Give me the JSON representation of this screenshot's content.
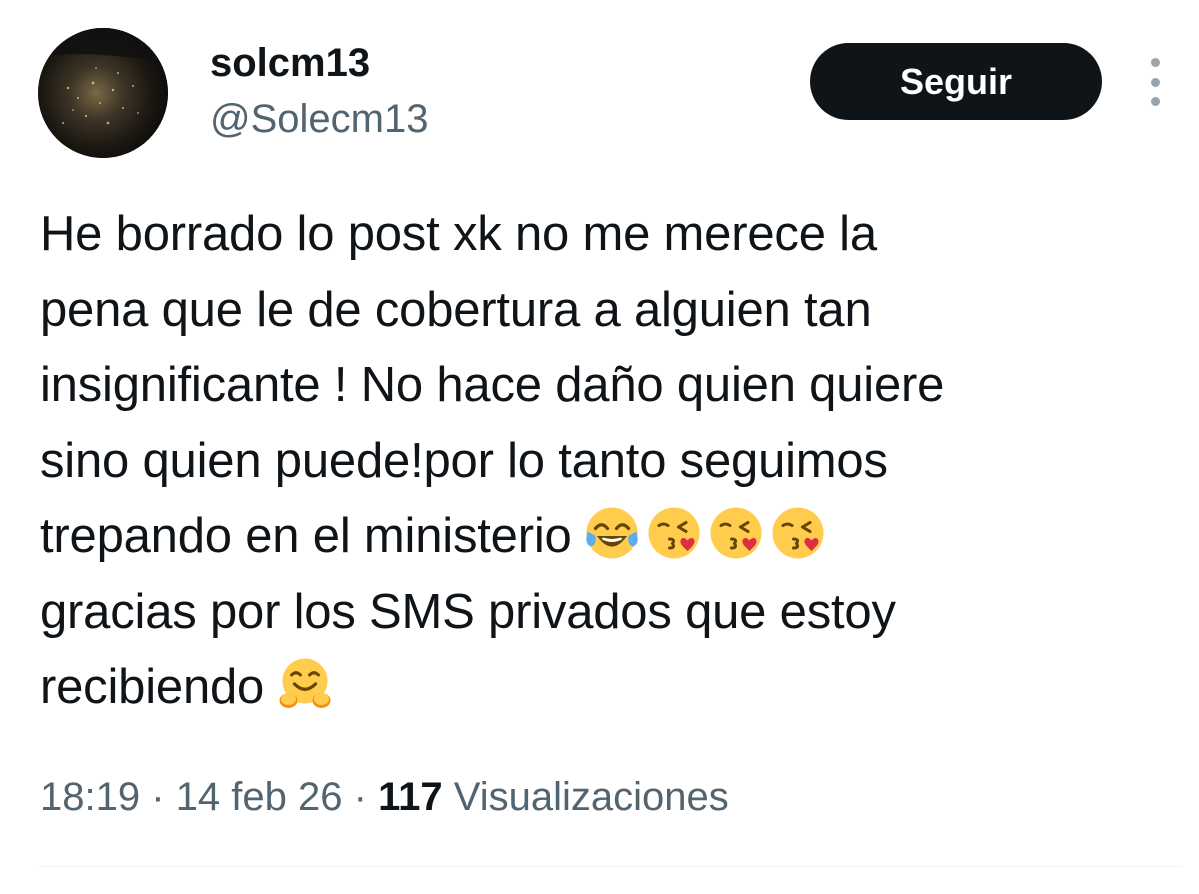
{
  "author": {
    "display_name": "solcm13",
    "handle": "@Solecm13"
  },
  "follow_button": {
    "label": "Seguir"
  },
  "more_menu": {
    "icon": "more-vertical-icon"
  },
  "post": {
    "lines": [
      "He borrado lo post xk no me merece la",
      "pena que le de cobertura a alguien tan",
      "insignificante ! No hace daño quien quiere",
      "sino quien puede!por lo tanto seguimos",
      "trepando en el ministerio",
      "gracias por los SMS privados que estoy",
      "recibiendo"
    ],
    "emojis_line5": [
      "face-with-tears-of-joy",
      "face-blowing-a-kiss",
      "face-blowing-a-kiss",
      "face-blowing-a-kiss"
    ],
    "emojis_line7": [
      "hugging-face"
    ]
  },
  "meta": {
    "time": "18:19",
    "sep1": "·",
    "date": "14 feb 26",
    "sep2": "·",
    "views_count": "117",
    "views_label": "Visualizaciones"
  },
  "colors": {
    "text": "#0f1419",
    "muted": "#536471",
    "button_bg": "#0f1419",
    "button_text": "#ffffff",
    "divider": "#eff3f4"
  }
}
